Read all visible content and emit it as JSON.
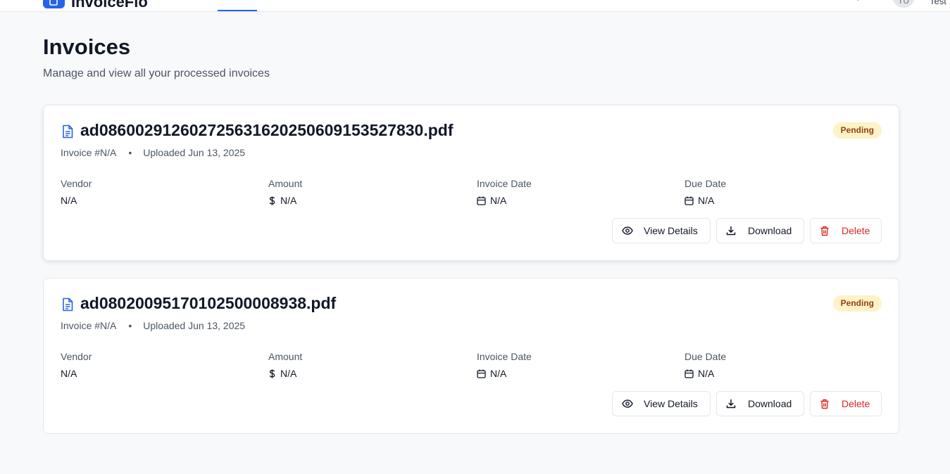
{
  "app": {
    "name": "InvoiceFlo",
    "user_initials": "TU",
    "user_name": "Test"
  },
  "page": {
    "title": "Invoices",
    "subtitle": "Manage and view all your processed invoices"
  },
  "labels": {
    "vendor": "Vendor",
    "amount": "Amount",
    "invoice_date": "Invoice Date",
    "due_date": "Due Date",
    "view_details": "View Details",
    "download": "Download",
    "delete": "Delete"
  },
  "invoices": [
    {
      "filename": "ad08600291260272563162025060915352783​0.pdf",
      "invoice_no": "Invoice #N/A",
      "uploaded": "Uploaded Jun 13, 2025",
      "status": "Pending",
      "vendor": "N/A",
      "amount": "N/A",
      "invoice_date": "N/A",
      "due_date": "N/A"
    },
    {
      "filename": "ad08020095170102500008938.pdf",
      "invoice_no": "Invoice #N/A",
      "uploaded": "Uploaded Jun 13, 2025",
      "status": "Pending",
      "vendor": "N/A",
      "amount": "N/A",
      "invoice_date": "N/A",
      "due_date": "N/A"
    }
  ],
  "colors": {
    "accent": "#2563eb",
    "badge_bg": "#fef3c7",
    "badge_text": "#92400e",
    "danger": "#dc2626"
  }
}
